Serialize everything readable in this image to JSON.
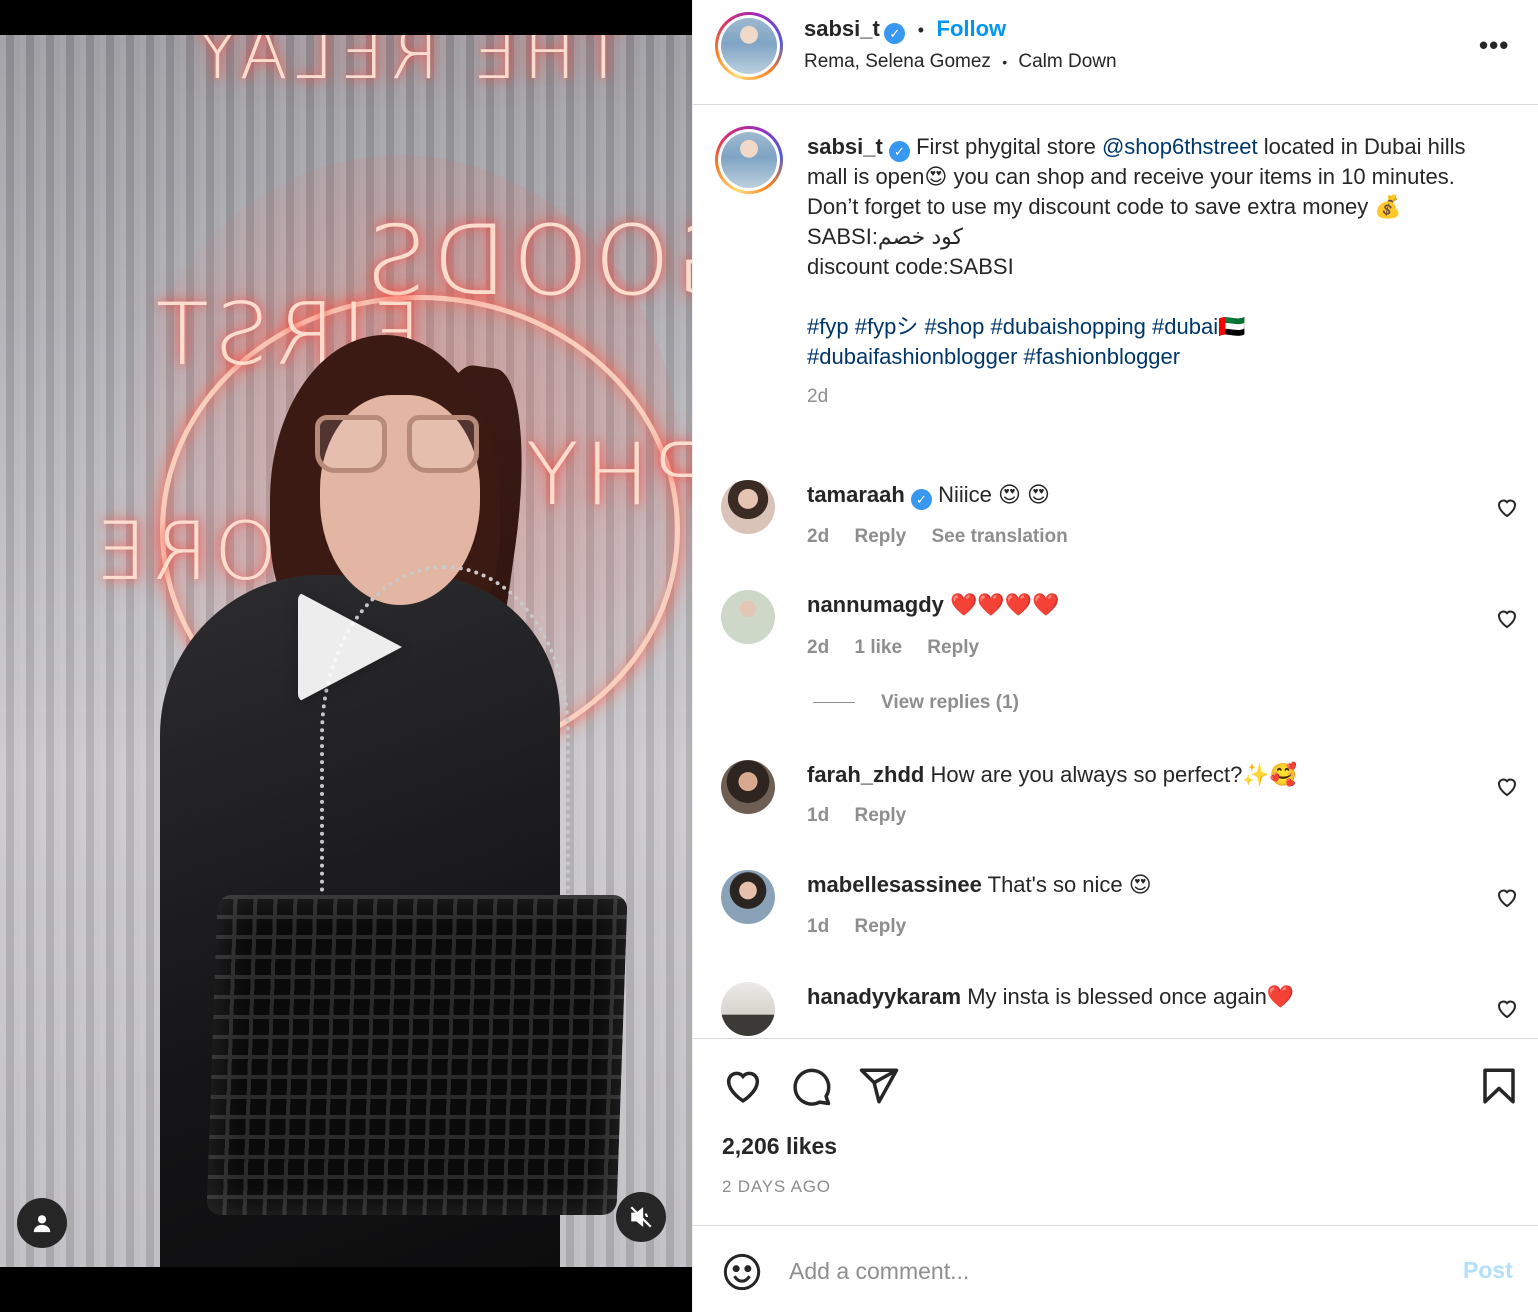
{
  "post": {
    "username": "sabsi_t",
    "verified_icon": "verified-badge-icon",
    "follow_label": "Follow",
    "separator": "•",
    "audio_artist": "Rema, Selena Gomez",
    "audio_title": "Calm Down",
    "more_label": "•••"
  },
  "caption": {
    "username": "sabsi_t",
    "text_1": "First phygital store",
    "mention": "@shop6thstreet",
    "text_2": "located in Dubai hills mall is open😍 you can shop and receive your items in 10 minutes. Don’t forget to use my discount code to save extra money 💰",
    "line_arabic": "كود خصم:SABSI",
    "line_code": "discount code:SABSI",
    "hashtags": [
      "#fyp",
      "#fypシ",
      "#shop",
      "#dubaishopping",
      "#dubai🇦🇪",
      "#dubaifashionblogger",
      "#fashionblogger"
    ],
    "time": "2d"
  },
  "comments": [
    {
      "username": "tamaraah",
      "verified": true,
      "text": "Niiice 😍 😍",
      "time": "2d",
      "actions": [
        "Reply",
        "See translation"
      ],
      "avatar_color": "#d9c3b8"
    },
    {
      "username": "nannumagdy",
      "verified": false,
      "text": "❤️❤️❤️❤️",
      "time": "2d",
      "actions": [
        "1 like",
        "Reply"
      ],
      "avatar_color": "#cdd8c8"
    },
    {
      "username": "farah_zhdd",
      "verified": false,
      "text": "How are you always so perfect?✨🥰",
      "time": "1d",
      "actions": [
        "Reply"
      ],
      "avatar_color": "#6f5e54"
    },
    {
      "username": "mabellesassinee",
      "verified": false,
      "text": "That's so nice 😍",
      "time": "1d",
      "actions": [
        "Reply"
      ],
      "avatar_color": "#8aa2b8"
    },
    {
      "username": "hanadyykaram",
      "verified": false,
      "text": "My insta is blessed once again❤️",
      "time": "",
      "actions": [],
      "avatar_color": "#d7d3cc"
    }
  ],
  "view_replies_label": "View replies (1)",
  "likes_label": "2,206 likes",
  "posted_label": "2 DAYS AGO",
  "add_comment": {
    "placeholder": "Add a comment...",
    "post_label": "Post"
  },
  "icons": {
    "play": "play-icon",
    "profile": "user-icon",
    "mute": "muted-speaker-icon",
    "like": "heart-icon",
    "comment": "comment-bubble-icon",
    "share": "paper-plane-icon",
    "save": "bookmark-icon",
    "emoji": "smiley-icon"
  },
  "colors": {
    "accent": "#0095f6",
    "link": "#00376b",
    "muted": "#8e8e8e",
    "post_disabled": "#b2dffc"
  }
}
